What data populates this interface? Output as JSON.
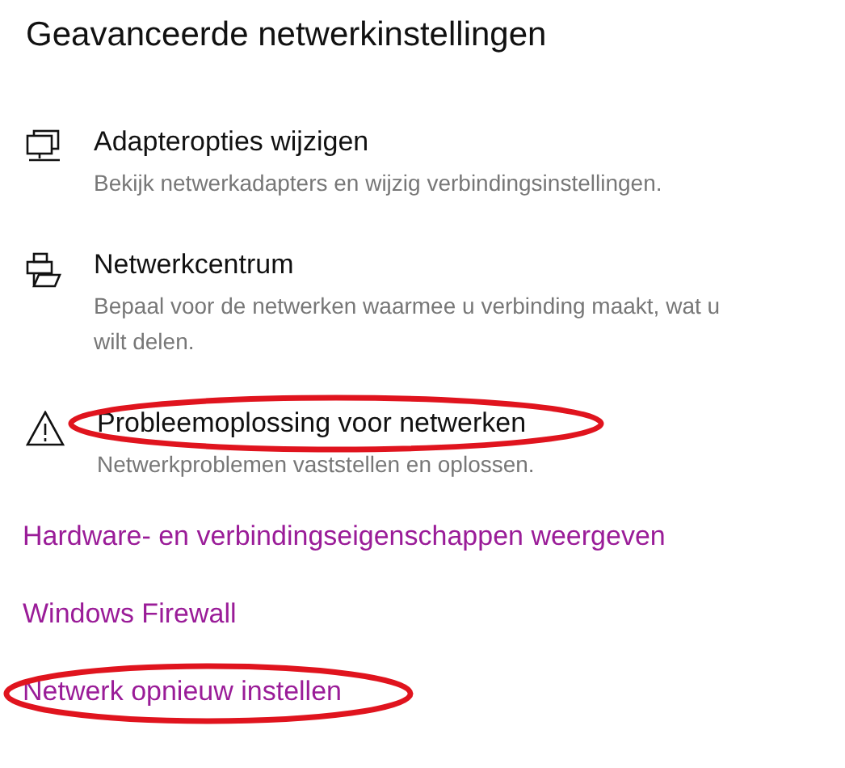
{
  "title": "Geavanceerde netwerkinstellingen",
  "items": [
    {
      "kind": "adapter",
      "title": "Adapteropties wijzigen",
      "description": "Bekijk netwerkadapters en wijzig verbindingsinstellingen.",
      "circled": false
    },
    {
      "kind": "center",
      "title": "Netwerkcentrum",
      "description": "Bepaal voor de netwerken waarmee u verbinding maakt, wat u\nwilt delen.",
      "circled": false
    },
    {
      "kind": "warning",
      "title": "Probleemoplossing voor netwerken",
      "description": "Netwerkproblemen vaststellen en oplossen.",
      "circled": true
    }
  ],
  "links": [
    {
      "label": "Hardware- en verbindingseigenschappen weergeven",
      "circled": false
    },
    {
      "label": "Windows Firewall",
      "circled": false
    },
    {
      "label": "Netwerk opnieuw instellen",
      "circled": true
    }
  ]
}
